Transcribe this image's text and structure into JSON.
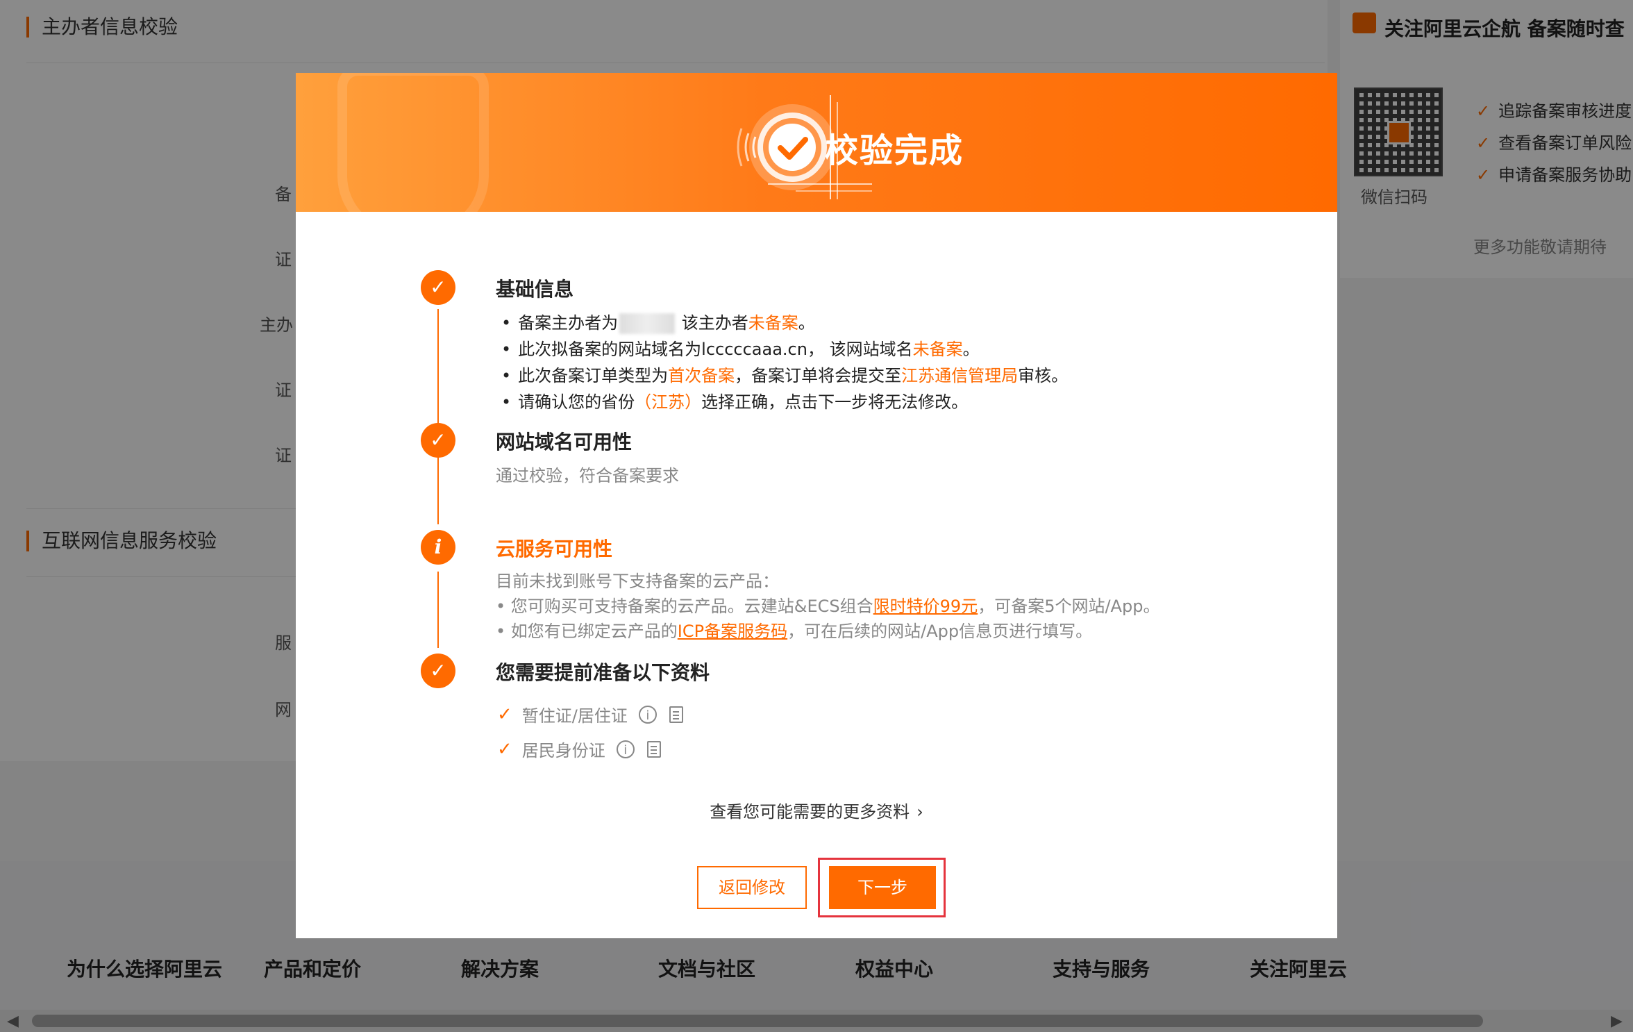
{
  "background": {
    "section1_title": "主办者信息校验",
    "section2_title": "互联网信息服务校验",
    "form_labels": [
      "备",
      "证",
      "主办",
      "证",
      "证",
      "服",
      "网"
    ],
    "right_panel": {
      "title": "关注阿里云企航 备案随时查",
      "qr_caption": "微信扫码",
      "items": [
        "追踪备案审核进度",
        "查看备案订单风险",
        "申请备案服务协助"
      ],
      "more": "更多功能敬请期待"
    },
    "footer_columns": [
      "为什么选择阿里云",
      "产品和定价",
      "解决方案",
      "文档与社区",
      "权益中心",
      "支持与服务",
      "关注阿里云"
    ]
  },
  "modal": {
    "title": "校验完成",
    "step1": {
      "title": "基础信息",
      "b1_pre": "备案主办者为",
      "b1_mid": " 该主办者",
      "b1_hl": "未备案",
      "b1_end": "。",
      "b2_pre": "此次拟备案的网站域名为lcccccaaa.cn， 该网站域名",
      "b2_hl": "未备案",
      "b2_end": "。",
      "b3_pre": "此次备案订单类型为",
      "b3_hl1": "首次备案",
      "b3_mid": "，备案订单将会提交至",
      "b3_hl2": "江苏通信管理局",
      "b3_end": "审核。",
      "b4_pre": "请确认您的省份",
      "b4_hl": "（江苏）",
      "b4_end": "选择正确，点击下一步将无法修改。"
    },
    "step2": {
      "title": "网站域名可用性",
      "desc": "通过校验，符合备案要求"
    },
    "step3": {
      "title": "云服务可用性",
      "desc": "目前未找到账号下支持备案的云产品：",
      "l1_pre": "• 您可购买可支持备案的云产品。云建站&ECS组合",
      "l1_link": "限时特价99元",
      "l1_end": "，可备案5个网站/App。",
      "l2_pre": "• 如您有已绑定云产品的",
      "l2_link": "ICP备案服务码",
      "l2_end": "，可在后续的网站/App信息页进行填写。"
    },
    "step4": {
      "title": "您需要提前准备以下资料",
      "docs": [
        "暂住证/居住证",
        "居民身份证"
      ]
    },
    "more_link": "查看您可能需要的更多资料",
    "btn_back": "返回修改",
    "btn_next": "下一步",
    "icons": {
      "check": "✓",
      "info": "i"
    },
    "accent": "#ff6a00"
  }
}
